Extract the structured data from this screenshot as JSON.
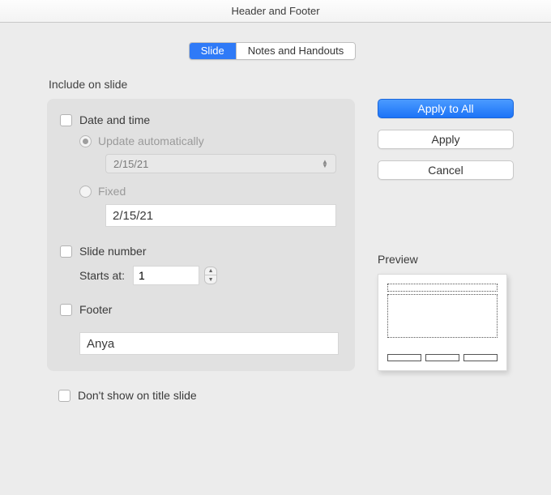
{
  "window": {
    "title": "Header and Footer"
  },
  "tabs": {
    "slide": "Slide",
    "notes": "Notes and Handouts"
  },
  "section": {
    "include": "Include on slide"
  },
  "dateTime": {
    "label": "Date and time",
    "auto": "Update automatically",
    "autoValue": "2/15/21",
    "fixed": "Fixed",
    "fixedValue": "2/15/21"
  },
  "slideNumber": {
    "label": "Slide number",
    "startsAt": "Starts at:",
    "startsValue": "1"
  },
  "footer": {
    "label": "Footer",
    "value": "Anya"
  },
  "dontShow": {
    "label": "Don't show on title slide"
  },
  "buttons": {
    "applyAll": "Apply to All",
    "apply": "Apply",
    "cancel": "Cancel"
  },
  "preview": {
    "label": "Preview"
  }
}
